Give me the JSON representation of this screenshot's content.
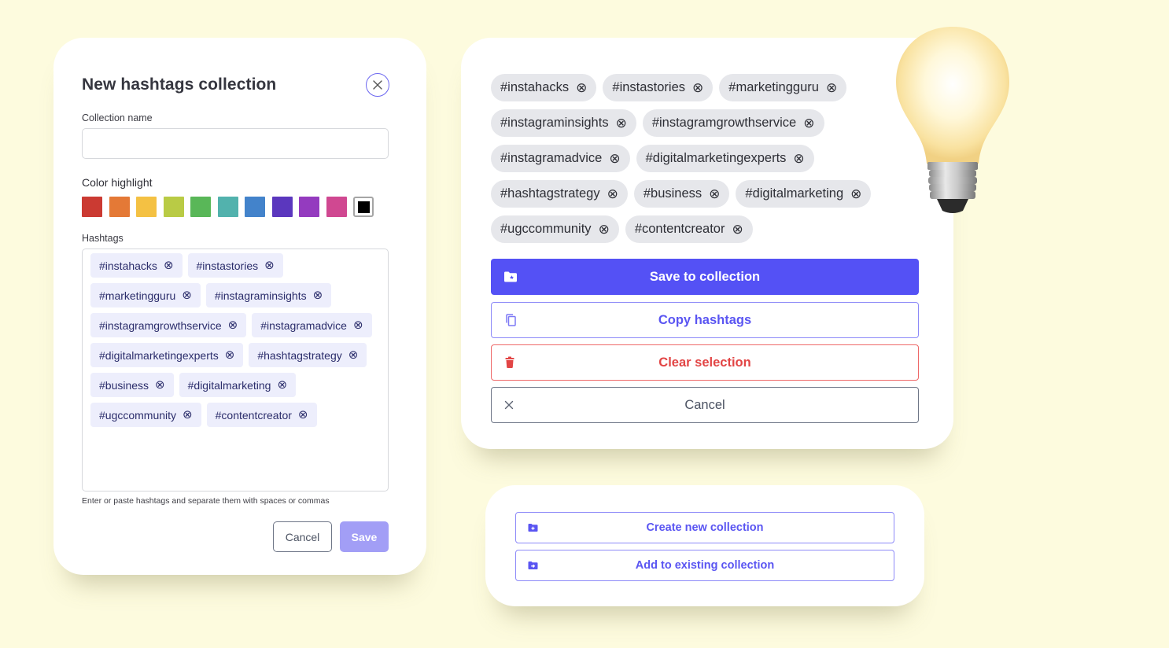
{
  "left_card": {
    "title": "New hashtags collection",
    "close_icon": "close-icon",
    "collection_name_label": "Collection name",
    "collection_name_value": "",
    "collection_name_placeholder": "",
    "color_label": "Color highlight",
    "colors": [
      "#CB3A32",
      "#E47936",
      "#F4C143",
      "#B9CB45",
      "#59B758",
      "#52B2AD",
      "#4383CB",
      "#5B37BE",
      "#943BBF",
      "#D04891",
      "#000000"
    ],
    "selected_color": "#000000",
    "hashtags_label": "Hashtags",
    "hashtags": [
      "#instahacks",
      "#instastories",
      "#marketingguru",
      "#instagraminsights",
      "#instagramgrowthservice",
      "#instagramadvice",
      "#digitalmarketingexperts",
      "#hashtagstrategy",
      "#business",
      "#digitalmarketing",
      "#ugccommunity",
      "#contentcreator"
    ],
    "remove_icon": "circle-x-icon",
    "help_text": "Enter or paste hashtags and separate them with spaces or commas",
    "cancel_label": "Cancel",
    "save_label": "Save"
  },
  "right_card": {
    "hashtags": [
      "#instahacks",
      "#instastories",
      "#marketingguru",
      "#instagraminsights",
      "#instagramgrowthservice",
      "#instagramadvice",
      "#digitalmarketingexperts",
      "#hashtagstrategy",
      "#business",
      "#digitalmarketing",
      "#ugccommunity",
      "#contentcreator"
    ],
    "buttons": {
      "save": {
        "label": "Save to collection",
        "icon": "folder-star-icon"
      },
      "copy": {
        "label": "Copy hashtags",
        "icon": "copy-icon"
      },
      "clear": {
        "label": "Clear selection",
        "icon": "trash-icon"
      },
      "cancel": {
        "label": "Cancel",
        "icon": "close-icon"
      }
    }
  },
  "lower_card": {
    "buttons": {
      "create": {
        "label": "Create new collection",
        "icon": "folder-plus-icon"
      },
      "add": {
        "label": "Add to existing collection",
        "icon": "folder-arrow-icon"
      }
    }
  },
  "decoration": {
    "icon": "lightbulb-icon"
  },
  "colors": {
    "background": "#FDFBDE",
    "primary": "#5451F5",
    "primary_disabled": "#A29EF6",
    "danger": "#E24545",
    "neutral": "#4B5262"
  }
}
